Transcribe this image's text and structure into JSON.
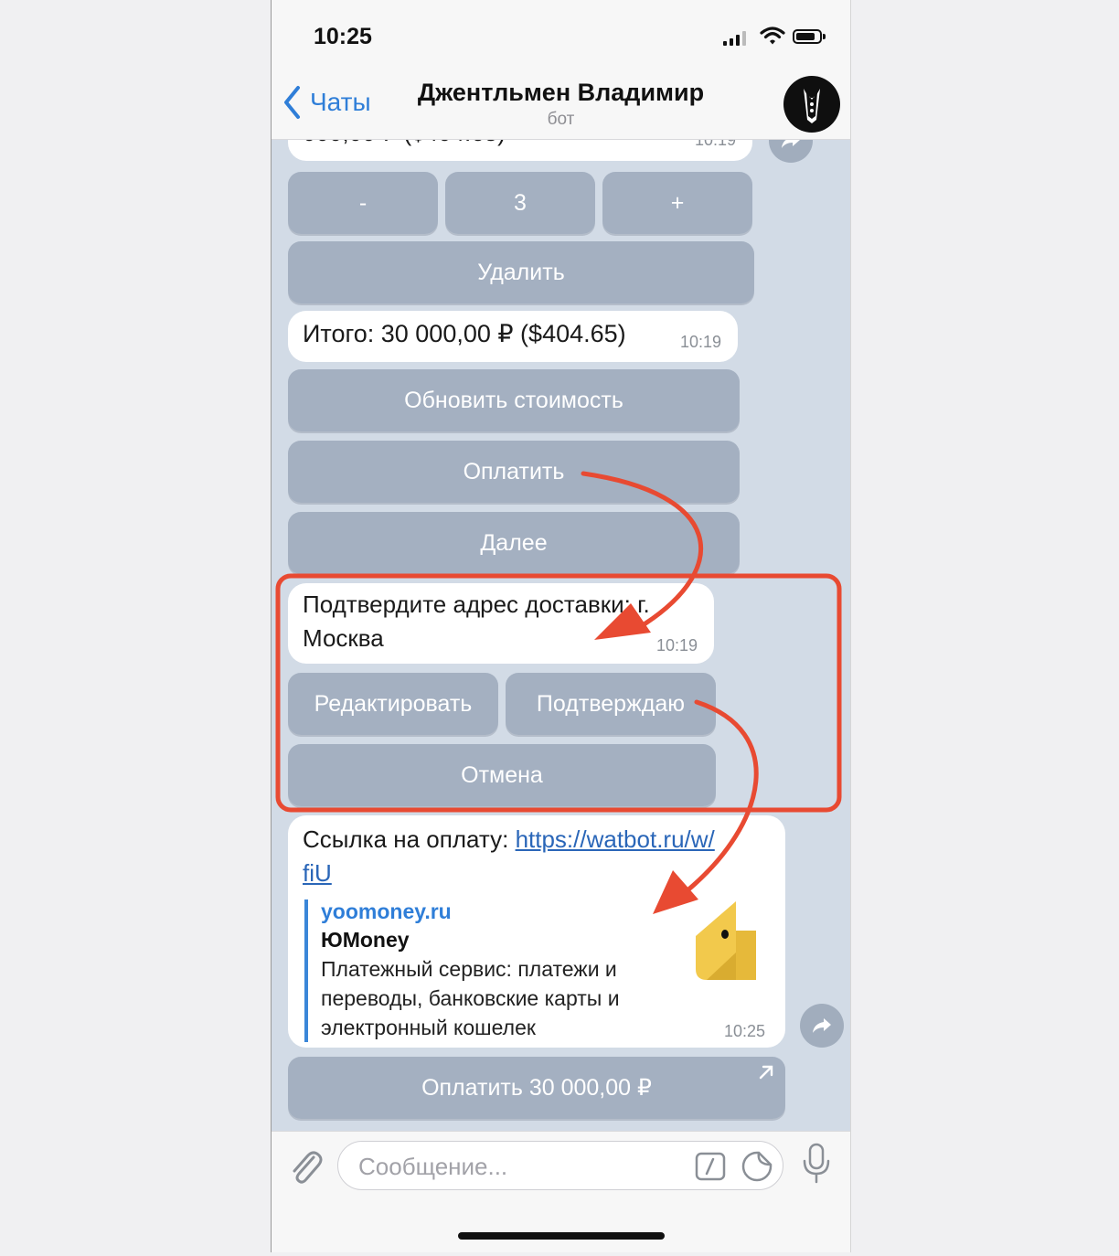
{
  "status_bar": {
    "time": "10:25"
  },
  "header": {
    "back_label": "Чаты",
    "title": "Джентльмен Владимир",
    "subtitle": "бот"
  },
  "messages": {
    "cut_message": {
      "text": "000,00 ₽ ($404.65)",
      "time": "10:19"
    },
    "quantity_keyboard": {
      "minus": "-",
      "count": "3",
      "plus": "+",
      "delete": "Удалить"
    },
    "total_message": {
      "text": "Итого: 30 000,00 ₽ ($404.65)",
      "time": "10:19"
    },
    "total_keyboard": {
      "update": "Обновить стоимость",
      "pay": "Оплатить",
      "next": "Далее"
    },
    "address_message": {
      "line1": "Подтвердите адрес доставки: г.",
      "line2": "Москва",
      "time": "10:19"
    },
    "address_keyboard": {
      "edit": "Редактировать",
      "confirm": "Подтверждаю",
      "cancel": "Отмена"
    },
    "payment_message": {
      "label": "Ссылка на оплату: ",
      "link_part1": "https://watbot.ru/w/",
      "link_part2": "fiU",
      "preview_site": "yoomoney.ru",
      "preview_title": "ЮMoney",
      "preview_desc_lines": [
        "Платежный сервис: платежи и",
        "переводы, банковские карты и",
        "электронный кошелек"
      ],
      "time": "10:25"
    },
    "pay_button": {
      "label": "Оплатить 30 000,00 ₽"
    }
  },
  "input": {
    "placeholder": "Сообщение..."
  },
  "colors": {
    "annotation": "#e84a32",
    "accent": "#2f7ed8",
    "chat_bg": "#d2dbe6"
  }
}
